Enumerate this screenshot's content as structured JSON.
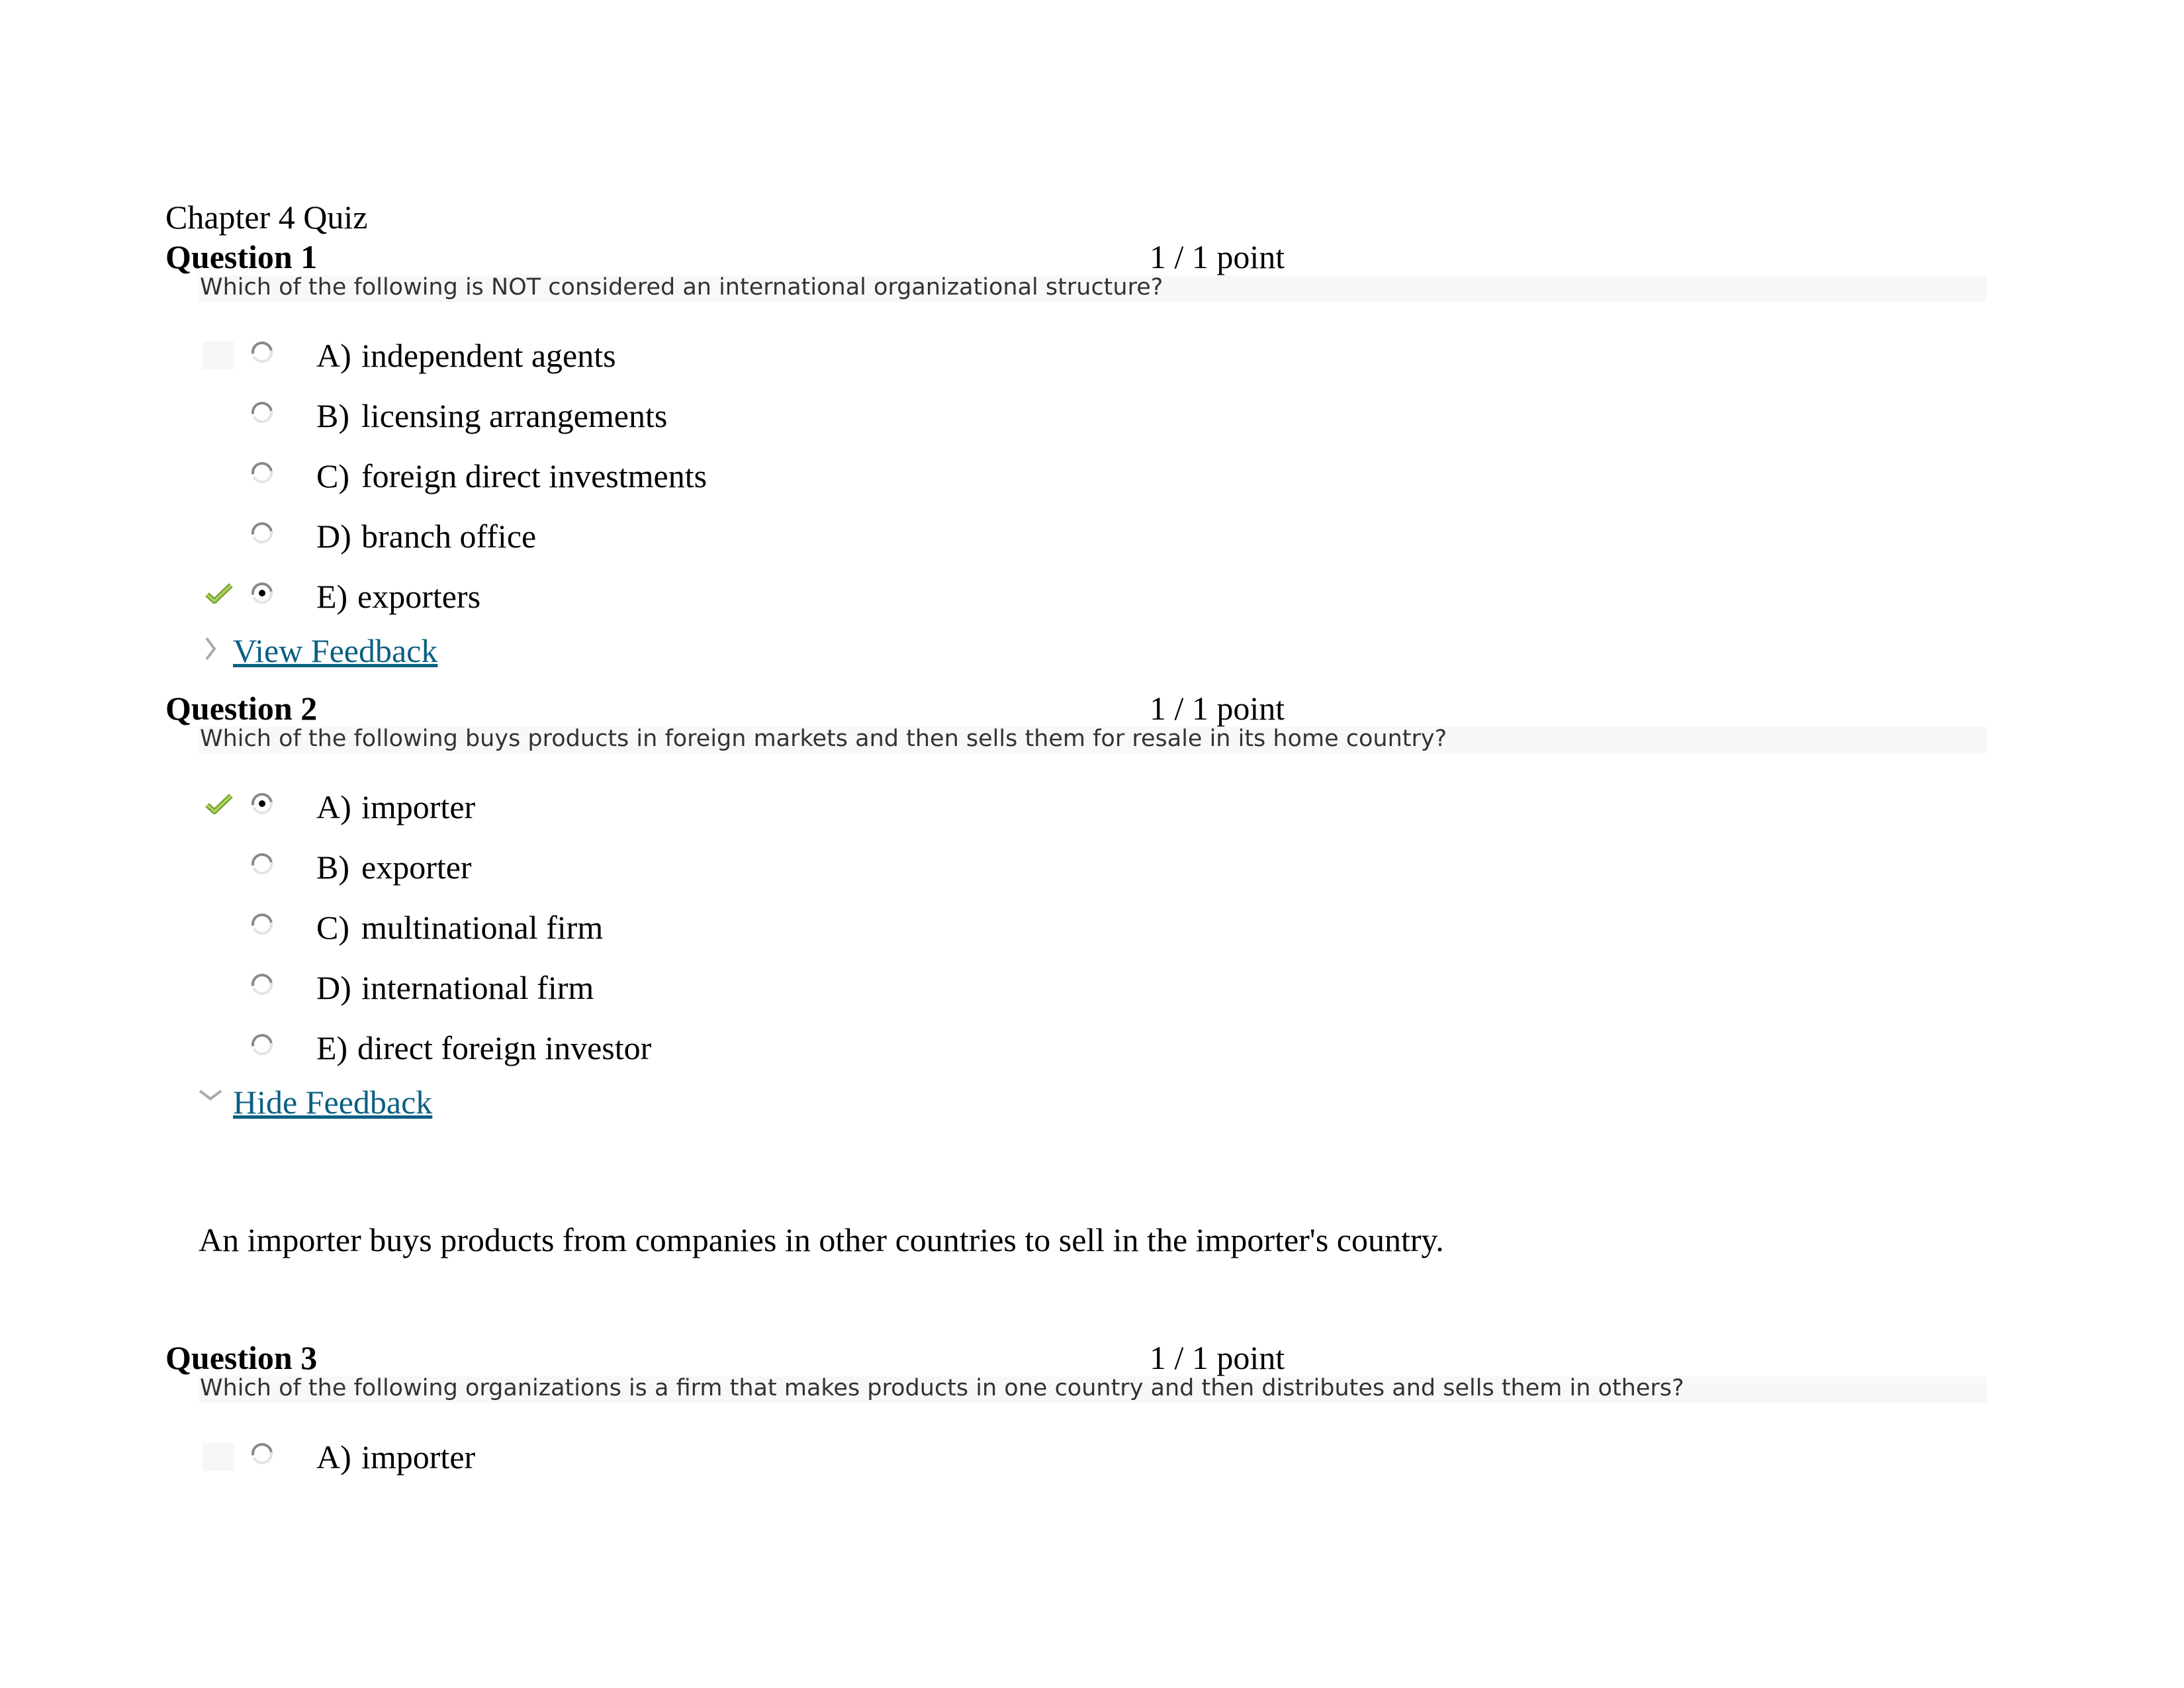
{
  "document": {
    "title": "Chapter 4 Quiz"
  },
  "colors": {
    "link": "#0b6082",
    "check": "#8cb43c",
    "question_band": "#f8f8f8",
    "question_text": "#333333"
  },
  "questions": [
    {
      "heading": "Question 1",
      "points": "1 / 1 point",
      "text": "Which of the following is NOT considered an international organizational structure?",
      "options": [
        {
          "letter": "A)",
          "text": "independent agents",
          "selected": false,
          "correct_mark": false
        },
        {
          "letter": "B)",
          "text": "licensing arrangements",
          "selected": false,
          "correct_mark": false
        },
        {
          "letter": "C)",
          "text": "foreign direct investments",
          "selected": false,
          "correct_mark": false
        },
        {
          "letter": "D)",
          "text": "branch office",
          "selected": false,
          "correct_mark": false
        },
        {
          "letter": "E)",
          "text": "exporters",
          "selected": true,
          "correct_mark": true
        }
      ],
      "feedback_toggle": {
        "label": "View Feedback",
        "icon": "chevron-right-icon",
        "expanded": false
      }
    },
    {
      "heading": "Question 2",
      "points": "1 / 1 point",
      "text": "Which of the following buys products in foreign markets and then sells them for resale in its home country?",
      "options": [
        {
          "letter": "A)",
          "text": "importer",
          "selected": true,
          "correct_mark": true
        },
        {
          "letter": "B)",
          "text": "exporter",
          "selected": false,
          "correct_mark": false
        },
        {
          "letter": "C)",
          "text": "multinational firm",
          "selected": false,
          "correct_mark": false
        },
        {
          "letter": "D)",
          "text": "international firm",
          "selected": false,
          "correct_mark": false
        },
        {
          "letter": "E)",
          "text": "direct foreign investor",
          "selected": false,
          "correct_mark": false
        }
      ],
      "feedback_toggle": {
        "label": "Hide Feedback",
        "icon": "chevron-down-icon",
        "expanded": true
      },
      "feedback": "An importer buys products from companies in other countries to sell in the importer's country."
    },
    {
      "heading": "Question 3",
      "points": "1 / 1 point",
      "text": "Which of the following organizations is a firm that makes products in one country and then distributes and sells them in others?",
      "options": [
        {
          "letter": "A)",
          "text": "importer",
          "selected": false,
          "correct_mark": false
        }
      ]
    }
  ]
}
